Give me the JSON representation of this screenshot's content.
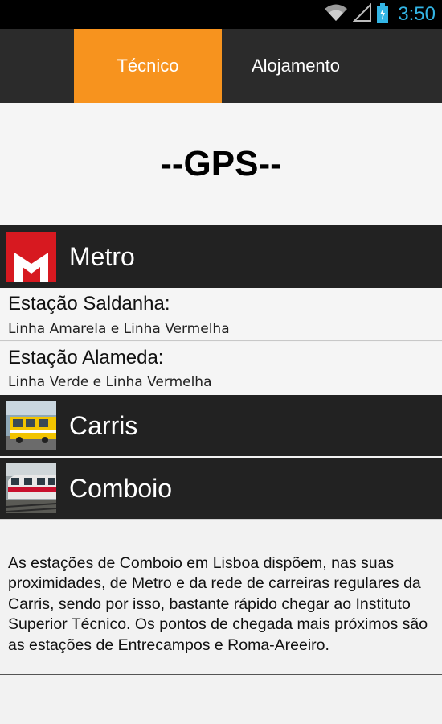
{
  "status_bar": {
    "time": "3:50",
    "icons": [
      "wifi-icon",
      "signal-icon",
      "battery-icon"
    ]
  },
  "tabs": [
    {
      "label": "Técnico",
      "active": true
    },
    {
      "label": "Alojamento",
      "active": false
    }
  ],
  "colors": {
    "accent": "#f7931e",
    "header_bg": "#2b2b2b",
    "row_bg": "#222222",
    "clock": "#33b5e5"
  },
  "page": {
    "title": "--GPS--"
  },
  "transport": {
    "metro": {
      "label": "Metro",
      "icon": "metro-logo-icon",
      "stations": [
        {
          "name": "Estação Saldanha:",
          "lines": "Linha Amarela e Linha Vermelha"
        },
        {
          "name": "Estação Alameda:",
          "lines": "Linha Verde e Linha Vermelha"
        }
      ]
    },
    "carris": {
      "label": "Carris",
      "icon": "bus-photo-icon"
    },
    "comboio": {
      "label": "Comboio",
      "icon": "train-photo-icon"
    }
  },
  "description": "As estações de Comboio em Lisboa dispõem, nas suas proximidades, de Metro e da rede de carreiras regulares da Carris, sendo por isso, bastante rápido chegar ao Instituto Superior Técnico. Os pontos de chegada mais próximos são as estações de Entrecampos e Roma-Areeiro."
}
